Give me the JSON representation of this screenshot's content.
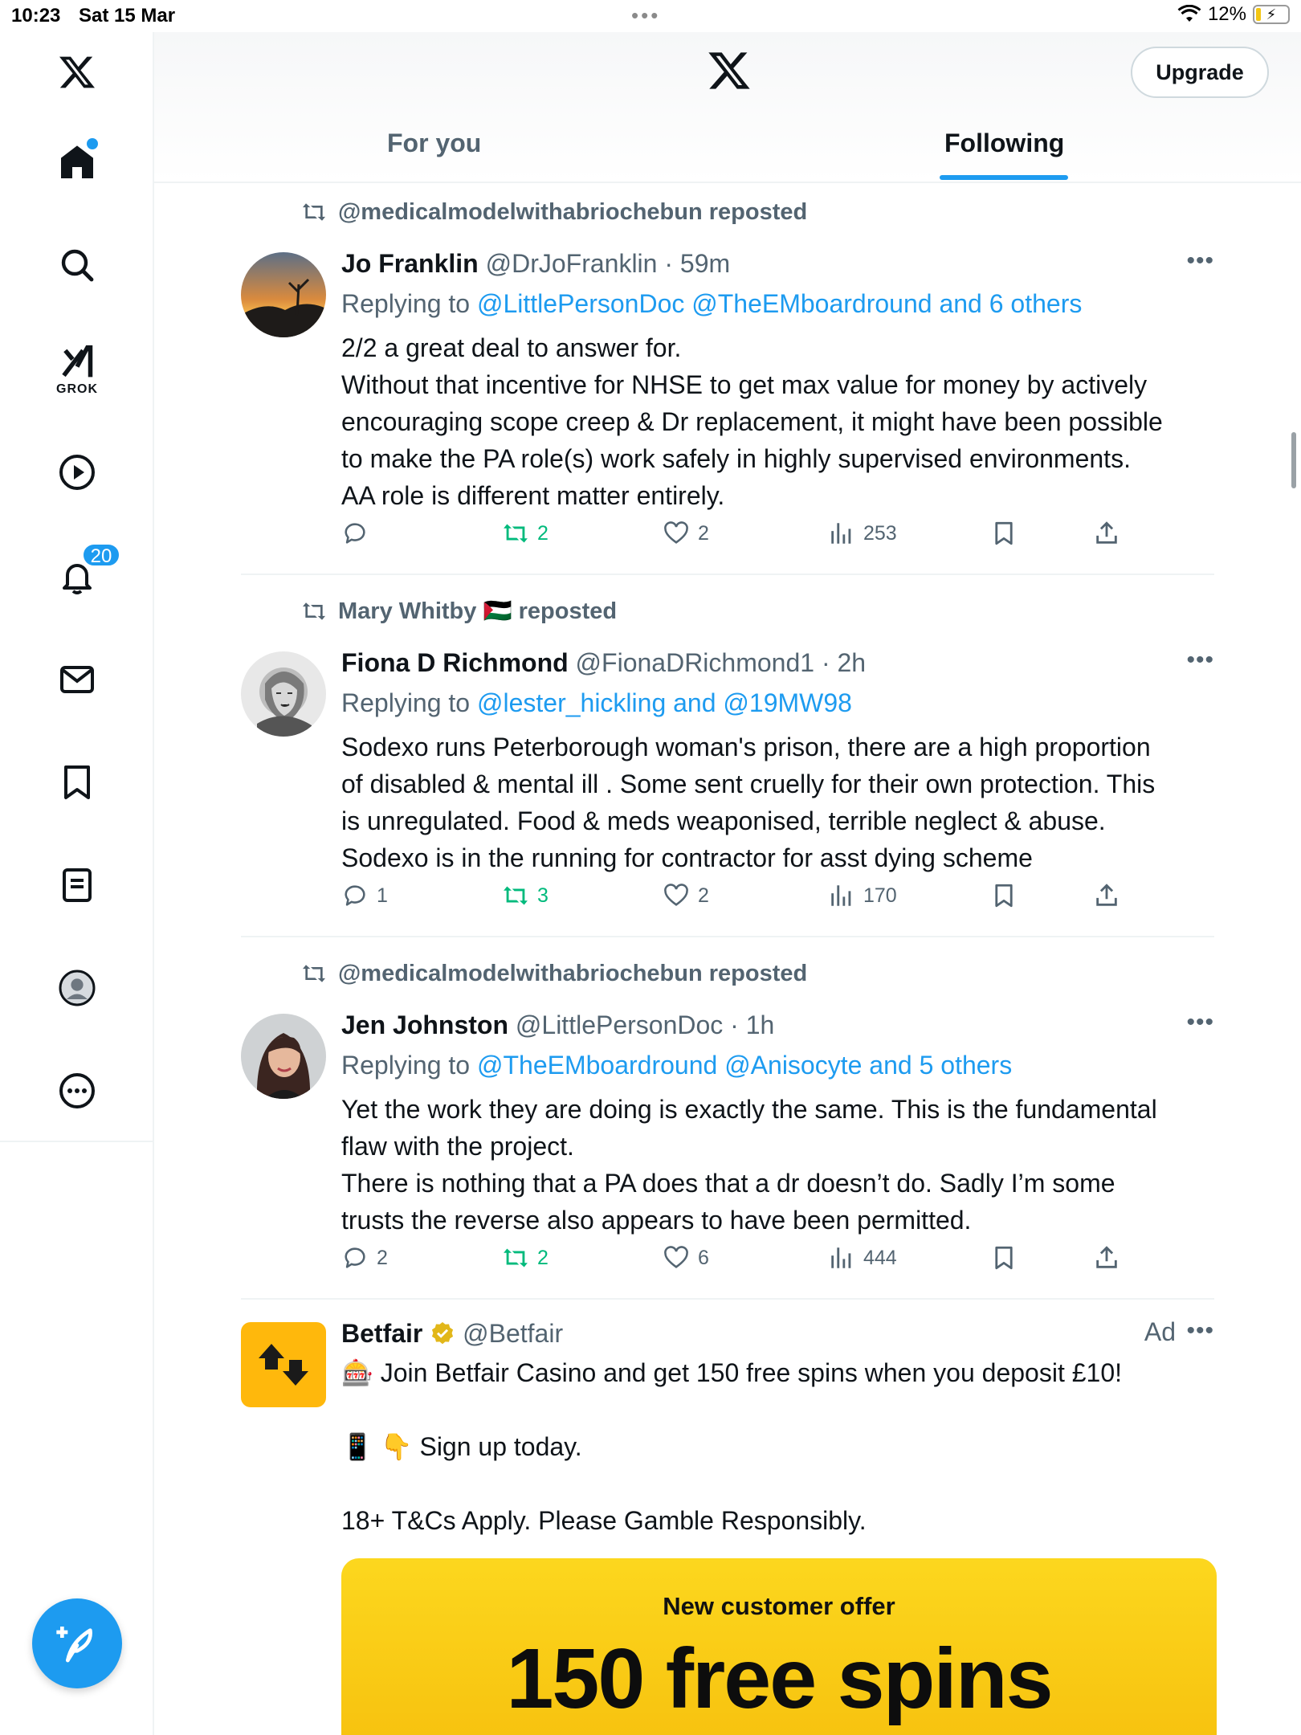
{
  "status": {
    "time": "10:23",
    "date": "Sat 15 Mar",
    "battery": "12%"
  },
  "header": {
    "upgrade_label": "Upgrade",
    "tabs": [
      {
        "label": "For you",
        "active": false
      },
      {
        "label": "Following",
        "active": true
      }
    ]
  },
  "sidebar": {
    "grok_label": "GROK",
    "notifications_count": "20",
    "items": [
      "x-logo",
      "home",
      "search",
      "grok",
      "videos",
      "notifications",
      "messages",
      "bookmarks",
      "lists",
      "profile",
      "more"
    ]
  },
  "tweets": [
    {
      "reposted_by": "@medicalmodelwithabriochebun reposted",
      "name": "Jo Franklin",
      "handle_time": "@DrJoFranklin · 59m",
      "replying_prefix": "Replying to",
      "replying_handles": "@LittlePersonDoc @TheEMboardround and 6 others",
      "lines": [
        "2/2 a great deal to answer for.",
        "Without that incentive for NHSE to get max value for money by actively",
        "encouraging scope creep & Dr replacement, it might have been possible",
        "to make the PA role(s) work safely in highly supervised environments.",
        "AA role is different matter entirely."
      ],
      "replies": "",
      "reposts": "2",
      "likes": "2",
      "views": "253"
    },
    {
      "reposted_by": "Mary Whitby 🇵🇸 reposted",
      "name": "Fiona D Richmond",
      "handle_time": "@FionaDRichmond1 · 2h",
      "replying_prefix": "Replying to",
      "replying_handles": "@lester_hickling and @19MW98",
      "lines": [
        "Sodexo runs Peterborough woman's prison, there are a high proportion",
        "of disabled & mental ill . Some sent cruelly for their own protection. This",
        "is unregulated. Food & meds weaponised, terrible neglect & abuse.",
        "Sodexo is in the running for contractor for asst dying scheme"
      ],
      "replies": "1",
      "reposts": "3",
      "likes": "2",
      "views": "170"
    },
    {
      "reposted_by": "@medicalmodelwithabriochebun reposted",
      "name": "Jen Johnston",
      "handle_time": "@LittlePersonDoc · 1h",
      "replying_prefix": "Replying to",
      "replying_handles": "@TheEMboardround @Anisocyte and 5 others",
      "lines": [
        "Yet the work they are doing is exactly the same. This is the fundamental",
        "flaw with the project.",
        "There is nothing that a PA does that a dr doesn’t do. Sadly I’m some",
        "trusts the reverse also appears to have been permitted."
      ],
      "replies": "2",
      "reposts": "2",
      "likes": "6",
      "views": "444"
    }
  ],
  "ad": {
    "name": "Betfair",
    "handle": "@Betfair",
    "ad_label": "Ad",
    "line1": "🎰 Join Betfair Casino and get 150 free spins when you deposit £10!",
    "line2": "📱 👇 Sign up today.",
    "line3": "18+ T&Cs Apply. Please Gamble Responsibly.",
    "card_sub": "New customer offer",
    "card_big": "150 free spins"
  },
  "colors": {
    "accent": "#1d9bf0",
    "repost_green": "#00ba7c",
    "muted": "#536471",
    "betfair_yellow": "#ffb80c"
  }
}
